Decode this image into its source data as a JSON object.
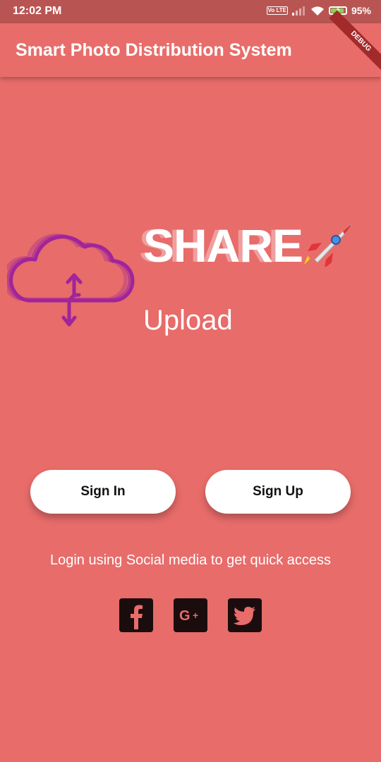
{
  "status_bar": {
    "time": "12:02 PM",
    "battery": "95%",
    "volte_label": "Vo LTE"
  },
  "app_bar": {
    "title": "Smart Photo Distribution System",
    "debug_label": "DEBUG"
  },
  "hero": {
    "title": "SHARE",
    "subtitle": "Upload"
  },
  "buttons": {
    "sign_in": "Sign In",
    "sign_up": "Sign Up"
  },
  "social": {
    "prompt": "Login using Social media to get quick access",
    "icons": [
      "facebook-icon",
      "google-plus-icon",
      "twitter-icon"
    ]
  },
  "colors": {
    "background": "#e76c6a",
    "status_bar": "#b85553",
    "accent_logo": "#a0249a",
    "icon_bg": "#1b0d0e"
  }
}
